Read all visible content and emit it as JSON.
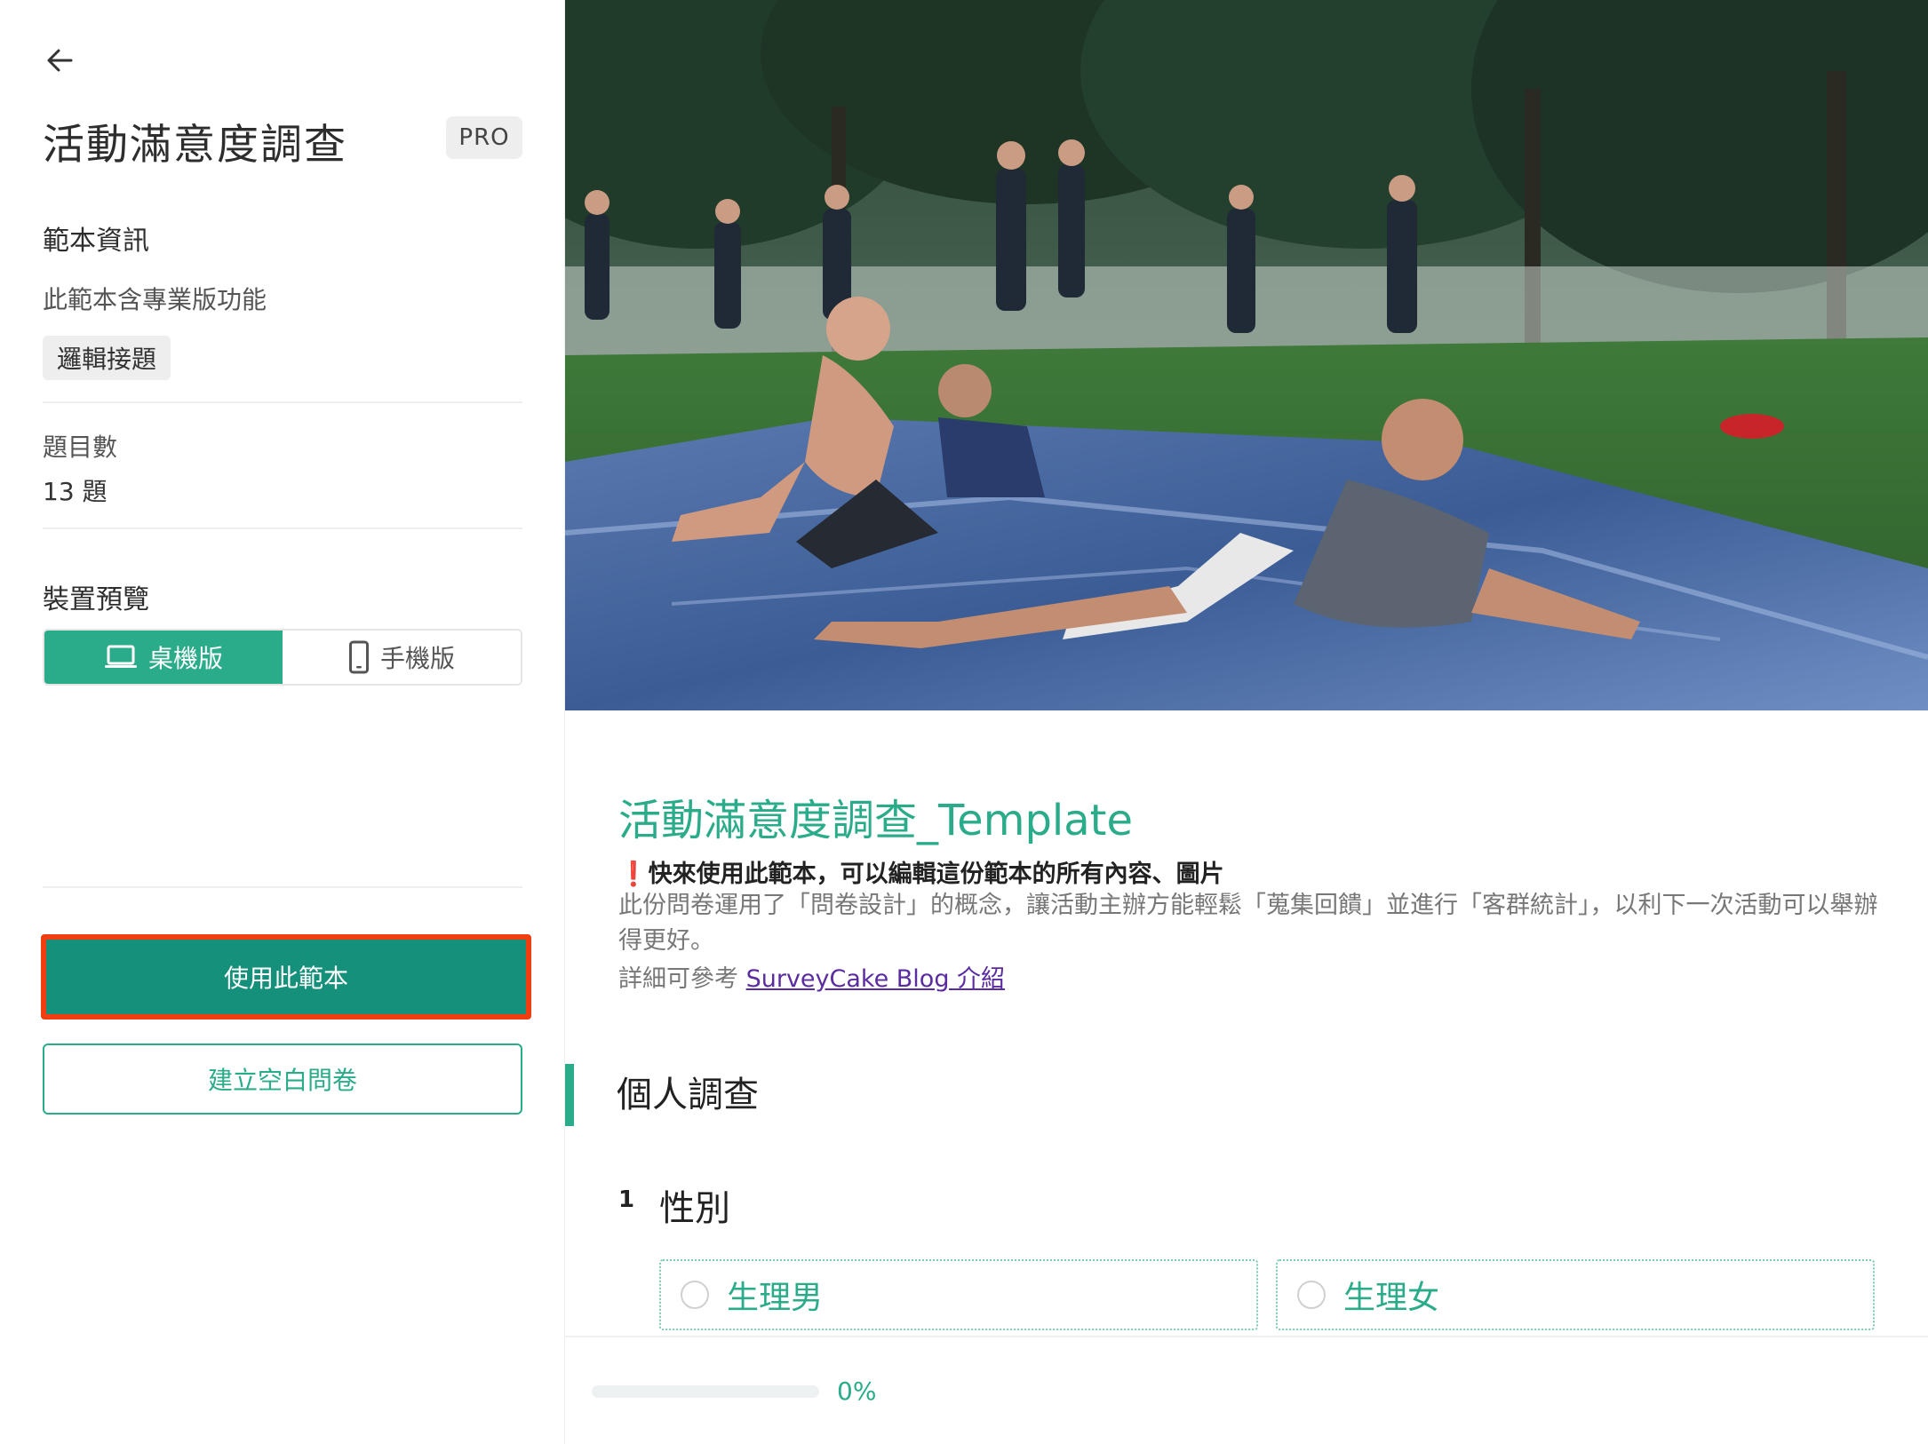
{
  "sidebar": {
    "title": "活動滿意度調查",
    "badge": "PRO",
    "template_info_heading": "範本資訊",
    "template_info_text": "此範本含專業版功能",
    "feature_tag": "邏輯接題",
    "question_count_label": "題目數",
    "question_count_value": "13 題",
    "device_preview_heading": "裝置預覽",
    "device_desktop": "桌機版",
    "device_mobile": "手機版",
    "use_template_button": "使用此範本",
    "create_blank_button": "建立空白問卷"
  },
  "preview": {
    "survey_title": "活動滿意度調查_Template",
    "notice_mark": "❗",
    "notice_text": "快來使用此範本，可以編輯這份範本的所有內容、圖片",
    "description": "此份問卷運用了「問卷設計」的概念，讓活動主辦方能輕鬆「蒐集回饋」並進行「客群統計」，以利下一次活動可以舉辦得更好。",
    "ref_prefix": "詳細可參考 ",
    "ref_link": "SurveyCake Blog 介紹",
    "section_title": "個人調查",
    "question_number": "1",
    "question_text": "性別",
    "options": [
      "生理男",
      "生理女"
    ],
    "progress_text": "0%",
    "progress_value": 0
  },
  "colors": {
    "accent": "#2aab8a",
    "primary_button": "#15907a",
    "highlight_border": "#f03d12"
  },
  "icons": {
    "back": "arrow-left-icon",
    "desktop": "laptop-icon",
    "mobile": "phone-icon"
  }
}
